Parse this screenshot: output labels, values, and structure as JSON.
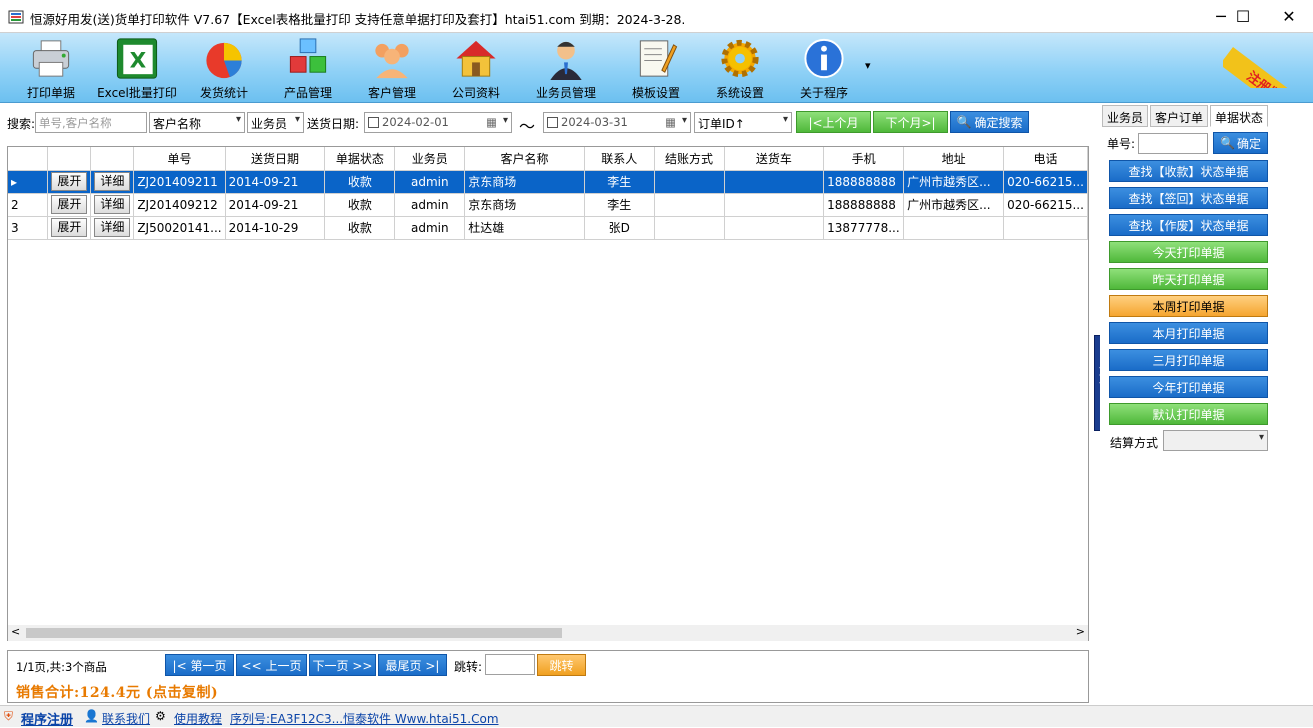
{
  "window": {
    "title": "恒源好用发(送)货单打印软件 V7.67【Excel表格批量打印 支持任意单据打印及套打】htai51.com   到期：2024-3-28.",
    "minimize": "─",
    "maximize": "☐",
    "close": "✕"
  },
  "toolbar": {
    "items": [
      {
        "label": "打印单据",
        "icon": "printer-icon"
      },
      {
        "label": "Excel批量打印",
        "icon": "excel-icon"
      },
      {
        "label": "发货统计",
        "icon": "pie-chart-icon"
      },
      {
        "label": "产品管理",
        "icon": "cubes-icon"
      },
      {
        "label": "客户管理",
        "icon": "users-icon"
      },
      {
        "label": "公司资料",
        "icon": "house-icon"
      },
      {
        "label": "业务员管理",
        "icon": "salesman-icon"
      },
      {
        "label": "模板设置",
        "icon": "notepad-icon"
      },
      {
        "label": "系统设置",
        "icon": "gear-icon"
      },
      {
        "label": "关于程序",
        "icon": "info-icon"
      }
    ],
    "more": "▾",
    "reg_banner": "注册版本"
  },
  "search": {
    "label": "搜索:",
    "placeholder": "单号,客户名称",
    "field_select": "客户名称",
    "salesman_select": "业务员",
    "date_label": "送货日期:",
    "date_from": "2024-02-01",
    "tilde": "～",
    "date_to": "2024-03-31",
    "order_select": "订单ID↑",
    "prev_month": "|<上个月",
    "next_month": "下个月>|",
    "confirm": "确定搜索"
  },
  "grid": {
    "columns": [
      "",
      "",
      "",
      "单号",
      "送货日期",
      "单据状态",
      "业务员",
      "客户名称",
      "联系人",
      "结账方式",
      "送货车",
      "手机",
      "地址",
      "电话"
    ],
    "rows": [
      {
        "idx": "",
        "expand": "展开",
        "detail": "详细",
        "no": "ZJ201409211",
        "date": "2014-09-21",
        "status": "收款",
        "salesman": "admin",
        "customer": "京东商场",
        "contact": "李生",
        "pay": "",
        "car": "",
        "mobile": "188888888",
        "addr": "广州市越秀区...",
        "tel": "020-66215..."
      },
      {
        "idx": "2",
        "expand": "展开",
        "detail": "详细",
        "no": "ZJ201409212",
        "date": "2014-09-21",
        "status": "收款",
        "salesman": "admin",
        "customer": "京东商场",
        "contact": "李生",
        "pay": "",
        "car": "",
        "mobile": "188888888",
        "addr": "广州市越秀区...",
        "tel": "020-66215..."
      },
      {
        "idx": "3",
        "expand": "展开",
        "detail": "详细",
        "no": "ZJ50020141...",
        "date": "2014-10-29",
        "status": "收款",
        "salesman": "admin",
        "customer": "杜达雄",
        "contact": "张D",
        "pay": "",
        "car": "",
        "mobile": "13877778...",
        "addr": "",
        "tel": ""
      }
    ],
    "scroll_left": "<",
    "scroll_right": ">"
  },
  "pager": {
    "info": "1/1页,共:3个商品",
    "first": "|< 第一页",
    "prev": "<< 上一页",
    "next": "下一页 >>",
    "last": "最尾页 >|",
    "jump_label": "跳转:",
    "jump_btn": "跳转",
    "sales": "销售合计:124.4元 (点击复制)"
  },
  "status": {
    "register": "程序注册",
    "contact": "联系我们",
    "tutorial": "使用教程",
    "serial": "序列号:EA3F12C3...",
    "site": "恒泰软件 Www.htai51.Com"
  },
  "right": {
    "tabs": [
      "业务员",
      "客户订单",
      "单据状态"
    ],
    "no_label": "单号:",
    "confirm": "确定",
    "buttons": [
      {
        "label": "查找【收款】状态单据",
        "color": "blue"
      },
      {
        "label": "查找【签回】状态单据",
        "color": "blue"
      },
      {
        "label": "查找【作废】状态单据",
        "color": "blue"
      },
      {
        "label": "今天打印单据",
        "color": "green"
      },
      {
        "label": "昨天打印单据",
        "color": "green"
      },
      {
        "label": "本周打印单据",
        "color": "orange"
      },
      {
        "label": "本月打印单据",
        "color": "blue"
      },
      {
        "label": "三月打印单据",
        "color": "blue"
      },
      {
        "label": "今年打印单据",
        "color": "blue"
      },
      {
        "label": "默认打印单据",
        "color": "green"
      }
    ],
    "settle_label": "结算方式"
  },
  "splitter": ">>>"
}
